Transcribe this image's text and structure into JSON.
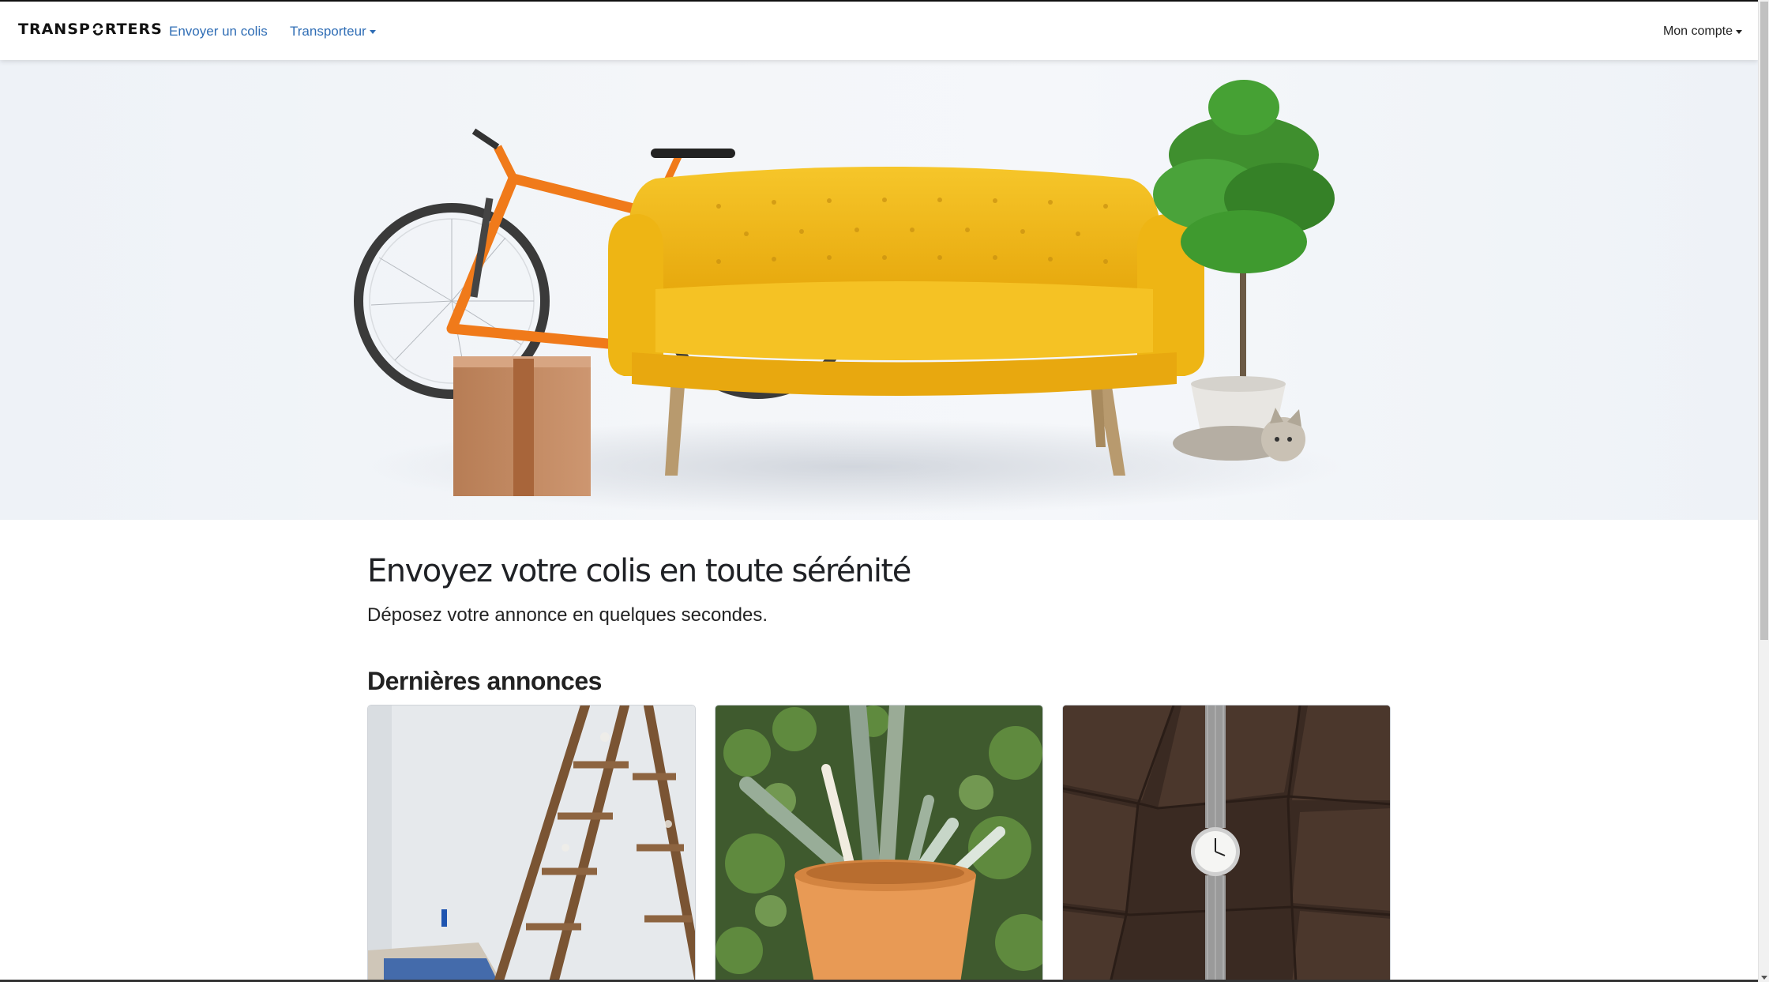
{
  "navbar": {
    "brand_left": "TRANSP",
    "brand_right": "RTERS",
    "links": [
      {
        "label": "Envoyer un colis"
      },
      {
        "label": "Transporteur"
      }
    ],
    "account_label": "Mon compte",
    "link_color": "#2f6db5"
  },
  "hero": {
    "icons": [
      "bicycle",
      "cardboard-box",
      "yellow-sofa",
      "potted-plant",
      "kitten"
    ]
  },
  "main": {
    "title": "Envoyez votre colis en toute sérénité",
    "subtitle": "Déposez votre annonce en quelques secondes.",
    "latest_title": "Dernières annonces"
  },
  "listings": [
    {
      "image": "wooden-ladder-photo"
    },
    {
      "image": "garden-tools-pot-photo"
    },
    {
      "image": "wristwatch-on-leather-photo"
    }
  ],
  "colors": {
    "sofa": "#f2bd1c",
    "bike_frame": "#f07a1a",
    "box": "#c58c62"
  }
}
